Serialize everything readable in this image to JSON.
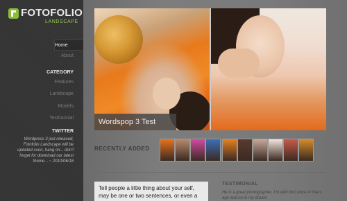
{
  "brand": {
    "title": "FOTOFOLIO",
    "subtitle": "LANDSCAPE",
    "accent": "#8bbd3a"
  },
  "nav": {
    "home": "Home",
    "about": "About"
  },
  "category": {
    "heading": "CATEGORY",
    "items": [
      "Features",
      "Landscape",
      "Models",
      "Testimonial"
    ]
  },
  "twitter": {
    "heading": "TWITTER",
    "text": "Wordpress 3 just released, Fotofolio Landscape will be updated soon, hang on... don't forget for download our latest theme... ~ 2010/06/18"
  },
  "slider": {
    "caption": "Wordspop 3 Test"
  },
  "recent": {
    "label": "RECENTLY ADDED",
    "thumb_colors": [
      "#e8711c",
      "#b78a6a",
      "#d14aa0",
      "#3a6fb8",
      "#e6801f",
      "#5a3a2e",
      "#c9a89a",
      "#f3e4dc",
      "#c85a4a",
      "#d58c2a"
    ]
  },
  "intro": {
    "text": "Tell people a little thing about your self, may be one or two sentences, or even a"
  },
  "testimonial": {
    "heading": "TESTIMONIAL",
    "text": "He is a great photographer, I'm with him since 4 Years ago and no in my dream"
  }
}
